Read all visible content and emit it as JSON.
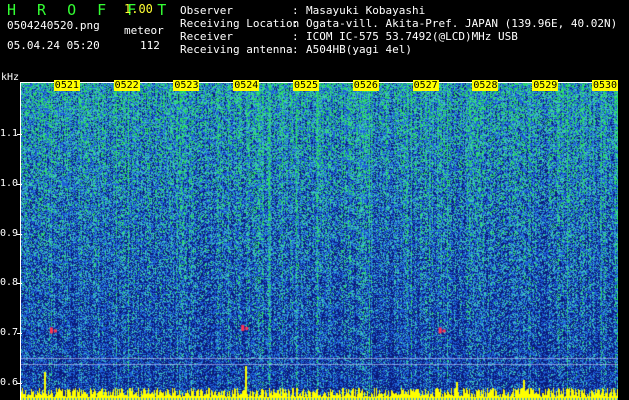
{
  "header": {
    "app_title": "H R O F F T",
    "version": "1.00",
    "file_name": "0504240520.png",
    "meteor_label": "meteor",
    "timestamp": "05.04.24 05:20",
    "meteor_count": "112"
  },
  "info": [
    {
      "label": "Observer",
      "sep": ":",
      "value": "Masayuki Kobayashi"
    },
    {
      "label": "Receiving Location",
      "sep": ":",
      "value": "Ogata-vill. Akita-Pref. JAPAN (139.96E, 40.02N)"
    },
    {
      "label": "Receiver",
      "sep": ":",
      "value": "ICOM IC-575 53.7492(@LCD)MHz USB"
    },
    {
      "label": "Receiving antenna",
      "sep": ":",
      "value": "A504HB(yagi 4el)"
    }
  ],
  "axis": {
    "y_unit": "kHz",
    "y_ticks": [
      {
        "label": "1.1",
        "value": 1.1
      },
      {
        "label": "1.0",
        "value": 1.0
      },
      {
        "label": "0.9",
        "value": 0.9
      },
      {
        "label": "0.8",
        "value": 0.8
      },
      {
        "label": "0.7",
        "value": 0.7
      },
      {
        "label": "0.6",
        "value": 0.6
      }
    ],
    "y_range": [
      0.565,
      1.205
    ],
    "x_ticks": [
      {
        "label": "0521",
        "minute": 1
      },
      {
        "label": "0522",
        "minute": 2
      },
      {
        "label": "0523",
        "minute": 3
      },
      {
        "label": "0524",
        "minute": 4
      },
      {
        "label": "0525",
        "minute": 5
      },
      {
        "label": "0526",
        "minute": 6
      },
      {
        "label": "0527",
        "minute": 7
      },
      {
        "label": "0528",
        "minute": 8
      },
      {
        "label": "0529",
        "minute": 9
      },
      {
        "label": "0530",
        "minute": 10
      }
    ],
    "x_range_minutes": [
      0,
      10
    ]
  },
  "colors": {
    "background": "#000000",
    "title": "#33ff33",
    "version": "#ffff33",
    "tick_label_bg": "#ffff00",
    "spectrogram_low": "#0a1a7a",
    "spectrogram_mid": "#1e60d8",
    "spectrogram_high": "#3fc7c0",
    "spectrogram_peak": "#ffff00",
    "meteor_echo": "#ff3355"
  },
  "events": [
    {
      "minute": 0.5,
      "freq_khz": 0.705
    },
    {
      "minute": 3.7,
      "freq_khz": 0.71
    },
    {
      "minute": 7.0,
      "freq_khz": 0.705
    }
  ]
}
